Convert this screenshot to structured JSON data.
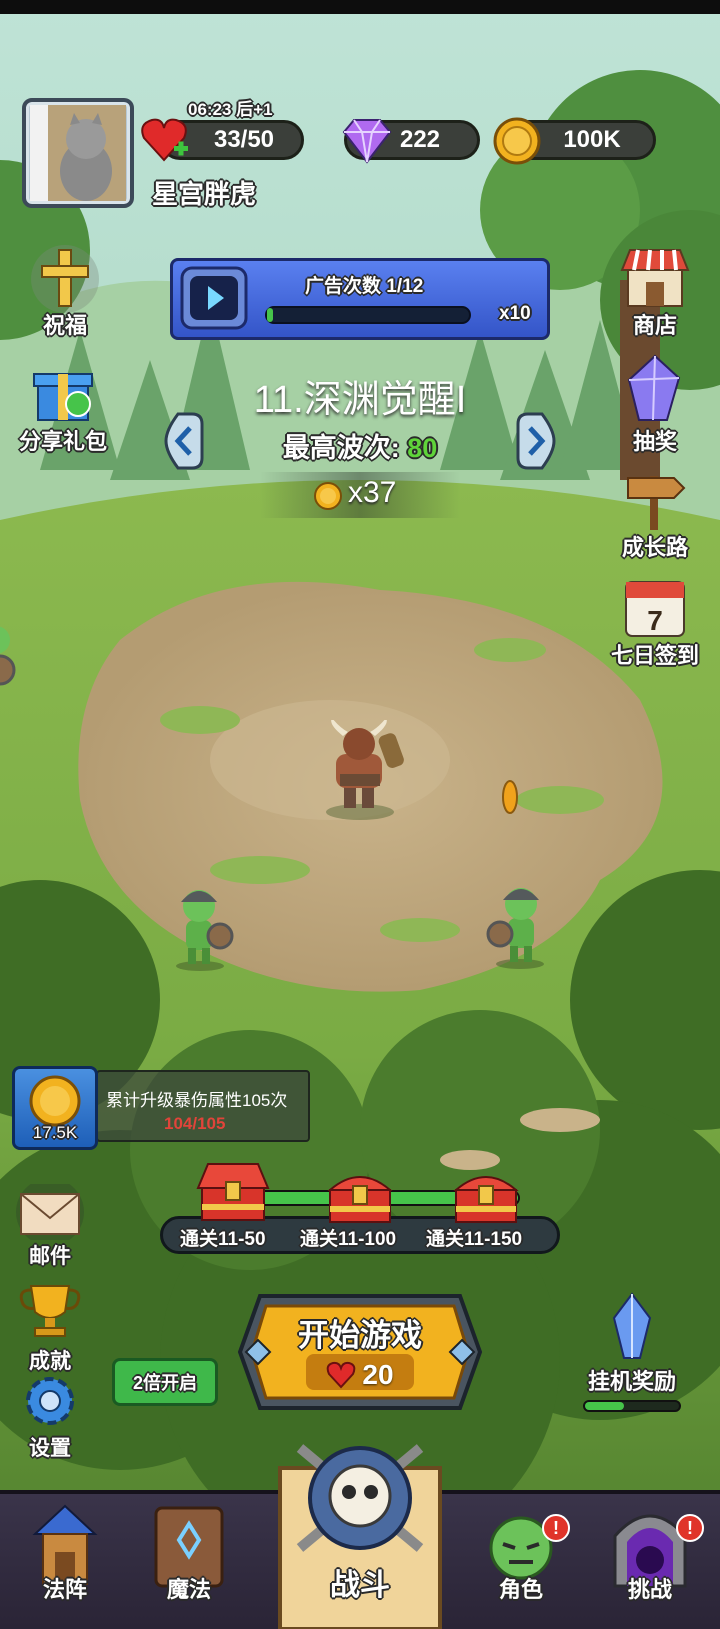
{
  "status": {
    "timer": "06:23",
    "timer_suffix": "后+1"
  },
  "player": {
    "name": "星宫胖虎"
  },
  "resources": {
    "hearts": "33/50",
    "gems": "222",
    "gold": "100K"
  },
  "ad_panel": {
    "label": "广告次数 1/12",
    "progress": 0.03,
    "multiplier": "x10"
  },
  "stage": {
    "title": "11.深渊觉醒I",
    "best_wave_label": "最高波次:",
    "best_wave_value": "80",
    "reward": "x37"
  },
  "left_menu": {
    "blessing": "祝福",
    "share_gift": "分享礼包"
  },
  "right_menu": {
    "shop": "商店",
    "lottery": "抽奖",
    "growth_path": "成长路",
    "seven_day": "七日签到",
    "calendar_day": "7"
  },
  "quest": {
    "amount": "17.5K",
    "description": "累计升级暴伤属性105次",
    "progress": "104/105"
  },
  "milestones": [
    {
      "label": "通关11-50"
    },
    {
      "label": "通关11-100"
    },
    {
      "label": "通关11-150"
    }
  ],
  "bottom_left": {
    "mail": "邮件",
    "achievement": "成就",
    "settings": "设置"
  },
  "double_button": "2倍开启",
  "start": {
    "label": "开始游戏",
    "cost": "20"
  },
  "idle_reward": {
    "label": "挂机奖励",
    "progress": 0.42
  },
  "nav": [
    {
      "label": "法阵",
      "badge": false
    },
    {
      "label": "魔法",
      "badge": false
    },
    {
      "label": "战斗",
      "badge": false
    },
    {
      "label": "角色",
      "badge": true
    },
    {
      "label": "挑战",
      "badge": true
    }
  ],
  "colors": {
    "accent_green": "#46c44a",
    "best_wave": "#5fd33a",
    "progress_red": "#e0443a",
    "start_button": "#f2b21f",
    "ad_panel": "#3c5fd6"
  }
}
